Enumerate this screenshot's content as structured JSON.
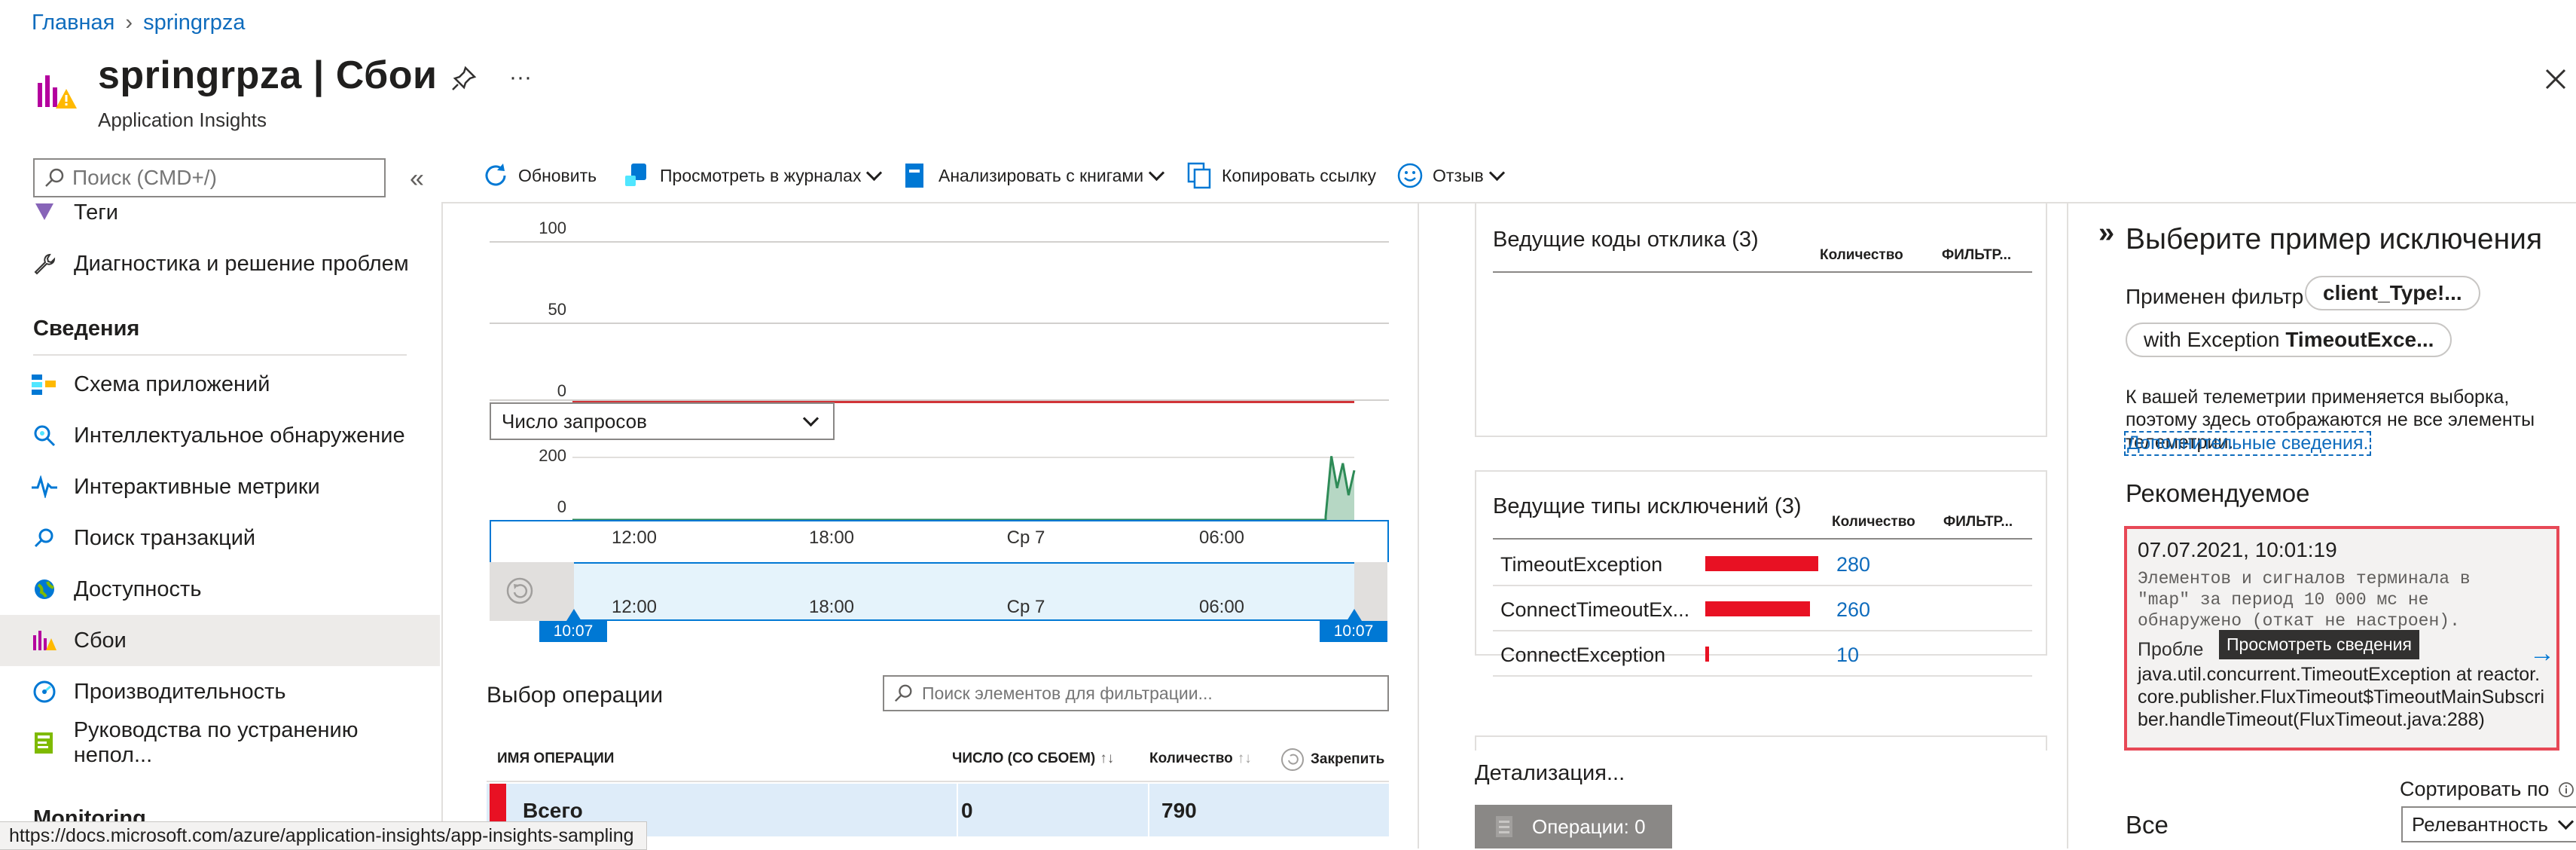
{
  "breadcrumb": {
    "home": "Главная",
    "current": "springrpza"
  },
  "header": {
    "title": "springrpza | Сбои",
    "subtitle": "Application Insights",
    "more": "···"
  },
  "sidebar": {
    "search_placeholder": "Поиск (CMD+/)",
    "partial_item": "Теги",
    "diag_item": "Диагностика и решение проблем",
    "section": "Сведения",
    "items": [
      {
        "label": "Схема приложений",
        "icon": "app-map-icon"
      },
      {
        "label": "Интеллектуальное обнаружение",
        "icon": "smart-detection-icon"
      },
      {
        "label": "Интерактивные метрики",
        "icon": "live-metrics-icon"
      },
      {
        "label": "Поиск транзакций",
        "icon": "search-icon"
      },
      {
        "label": "Доступность",
        "icon": "globe-icon"
      },
      {
        "label": "Сбои",
        "icon": "failures-icon",
        "active": true
      },
      {
        "label": "Производительность",
        "icon": "performance-icon"
      },
      {
        "label": "Руководства по устранению непол...",
        "icon": "guide-icon"
      }
    ],
    "partial_bottom": "Monitoring"
  },
  "toolbar": {
    "refresh": "Обновить",
    "logs": "Просмотреть в журналах",
    "workbooks": "Анализировать с книгами",
    "copy_link": "Копировать ссылку",
    "feedback": "Отзыв"
  },
  "chart": {
    "metric_select": "Число запросов",
    "y_ticks_top": [
      "100",
      "50",
      "0"
    ],
    "y_ticks_bottom": [
      "200",
      "0"
    ],
    "x_ticks": [
      "12:00",
      "18:00",
      "Ср 7",
      "06:00"
    ],
    "range_start": "10:07",
    "range_end": "10:07"
  },
  "chart_data": {
    "type": "area",
    "title": "",
    "xlabel": "",
    "ylabel": "",
    "series": [
      {
        "values": [
          0,
          0,
          0,
          0,
          0,
          0,
          0,
          0,
          0,
          0,
          0,
          0,
          0,
          0,
          0,
          0,
          0,
          0,
          0,
          0,
          0,
          0,
          0,
          0,
          10,
          180,
          90,
          160,
          70,
          140
        ]
      }
    ],
    "ylim_top": [
      0,
      100
    ],
    "ylim_bottom": [
      0,
      200
    ],
    "grid": true,
    "color": "#2e8b57",
    "failure_line_color": "#d13438"
  },
  "operations": {
    "title": "Выбор операции",
    "search_placeholder": "Поиск элементов для фильтрации...",
    "columns": {
      "name": "ИМЯ ОПЕРАЦИИ",
      "failed": "ЧИСЛО (СО СБОЕМ)",
      "count": "Количество",
      "pin": "Закрепить"
    },
    "row": {
      "name": "Всего",
      "failed": "0",
      "count": "790"
    }
  },
  "response_codes": {
    "title": "Ведущие коды отклика (3)",
    "col_count": "Количество",
    "col_filter": "ФИЛЬТР..."
  },
  "exception_types": {
    "title": "Ведущие типы исключений (3)",
    "col_count": "Количество",
    "col_filter": "ФИЛЬТР...",
    "rows": [
      {
        "name": "TimeoutException",
        "count": "280",
        "value": 280
      },
      {
        "name": "ConnectTimeoutEx...",
        "count": "260",
        "value": 260
      },
      {
        "name": "ConnectException",
        "count": "10",
        "value": 10
      }
    ],
    "bar_color": "#e81123"
  },
  "drill": {
    "title": "Детализация...",
    "ops_button": "Операции: 0"
  },
  "right_panel": {
    "title": "Выберите пример исключения",
    "filter_label": "Применен фильтр",
    "filter_pill": "client_Type!...",
    "exception_prefix": "with Exception ",
    "exception_bold": "TimeoutExce...",
    "sampling_note": "К вашей телеметрии применяется выборка, поэтому здесь отображаются не все элементы телеметрии.",
    "more_info": "Дополнительные сведения.",
    "recommended": "Рекомендуемое",
    "card": {
      "time": "07.07.2021, 10:01:19",
      "message": "Элементов и сигналов терминала в \"map\" за период 10 000 мс не обнаружено (откат не настроен).",
      "problem_prefix": "Пробле",
      "tooltip": "Просмотреть сведения",
      "stack": "java.util.concurrent.TimeoutException at reactor.core.publisher.FluxTimeout$TimeoutMainSubscriber.handleTimeout(FluxTimeout.java:288)"
    },
    "sort_label": "Сортировать по",
    "sort_value": "Релевантность",
    "all_label": "Все"
  },
  "status_url": "https://docs.microsoft.com/azure/application-insights/app-insights-sampling"
}
